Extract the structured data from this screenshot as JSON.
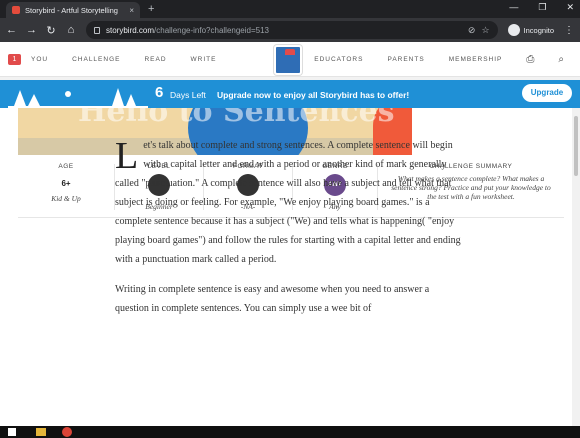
{
  "browser": {
    "tab_title": "Storybird - Artful Storytelling",
    "tab_close": "×",
    "new_tab": "+",
    "url_host": "storybird.com",
    "url_path": "/challenge-info?challengeid=513",
    "profile_label": "Incognito",
    "window_controls": [
      "—",
      "❐",
      "✕"
    ]
  },
  "nav": {
    "badge": "1",
    "left_links": [
      "YOU",
      "CHALLENGE",
      "READ",
      "WRITE"
    ],
    "right_links": [
      "EDUCATORS",
      "PARENTS",
      "MEMBERSHIP"
    ]
  },
  "promo": {
    "days_count": "6",
    "days_label": "Days Left",
    "message": "Upgrade now to enjoy all Storybird has to offer!",
    "button": "Upgrade"
  },
  "hero": {
    "heading": "Hello to Sentences"
  },
  "stats": {
    "age": {
      "label": "AGE",
      "value": "6+",
      "sub": "Kid & Up"
    },
    "level": {
      "label": "LEVEL",
      "sub": "Beginner"
    },
    "format": {
      "label": "FORMAT",
      "sub": "-NA-"
    },
    "genre": {
      "label": "GENRE",
      "icon_text": "ANY",
      "sub": "Any"
    },
    "summary": {
      "label": "CHALLENGE SUMMARY",
      "text": "What makes a sentence complete? What makes a sentence strong? Practice and put your knowledge to the test with a fun worksheet."
    }
  },
  "article": {
    "dropcap": "L",
    "p1": "et's talk about complete and strong sentences.  A complete sentence will begin with a capital letter and end with a period or another kind of mark generally called \"punctuation.\" A complete sentence will also have a subject and tell what that subject is doing or feeling.  For example, \"We enjoy playing board games.\" is a complete sentence because it has a subject (\"We) and tells what is happening( \"enjoy playing board games\") and follow the rules for starting with a capital letter and ending with a punctuation mark called a period.",
    "p2": "Writing in complete sentence is easy and awesome when you need to answer a question in complete sentences.  You can simply use a wee bit of"
  },
  "colors": {
    "promo_blue": "#1f90d6",
    "brand_red": "#e14b4b"
  }
}
